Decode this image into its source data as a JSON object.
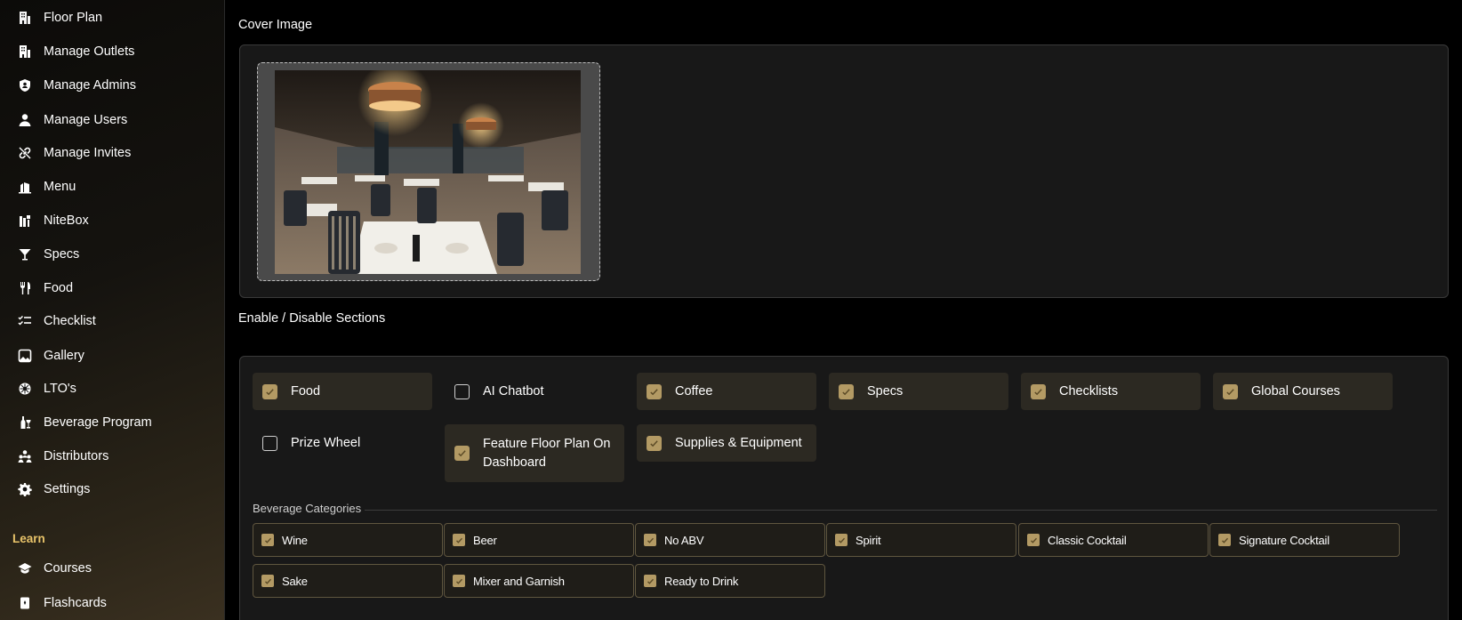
{
  "sidebar": {
    "items": [
      {
        "label": "Floor Plan",
        "icon": "building-icon"
      },
      {
        "label": "Manage Outlets",
        "icon": "store-icon"
      },
      {
        "label": "Manage Admins",
        "icon": "shield-user-icon"
      },
      {
        "label": "Manage Users",
        "icon": "user-icon"
      },
      {
        "label": "Manage Invites",
        "icon": "link-icon"
      },
      {
        "label": "Menu",
        "icon": "menu-book-icon"
      },
      {
        "label": "NiteBox",
        "icon": "box-icon"
      },
      {
        "label": "Specs",
        "icon": "cocktail-glass-icon"
      },
      {
        "label": "Food",
        "icon": "fork-knife-icon"
      },
      {
        "label": "Checklist",
        "icon": "checklist-icon"
      },
      {
        "label": "Gallery",
        "icon": "image-icon"
      },
      {
        "label": "LTO's",
        "icon": "dharma-wheel-icon"
      },
      {
        "label": "Beverage Program",
        "icon": "wine-bottle-icon"
      },
      {
        "label": "Distributors",
        "icon": "group-icon"
      },
      {
        "label": "Settings",
        "icon": "gear-icon"
      }
    ],
    "learn_section": "Learn",
    "learn_items": [
      {
        "label": "Courses",
        "icon": "graduation-cap-icon"
      },
      {
        "label": "Flashcards",
        "icon": "flashcard-icon"
      }
    ]
  },
  "main": {
    "cover_title": "Cover Image",
    "sections_title": "Enable / Disable Sections",
    "sections": [
      {
        "label": "Food",
        "checked": true
      },
      {
        "label": "AI Chatbot",
        "checked": false
      },
      {
        "label": "Coffee",
        "checked": true
      },
      {
        "label": "Specs",
        "checked": true
      },
      {
        "label": "Checklists",
        "checked": true
      },
      {
        "label": "Global Courses",
        "checked": true
      },
      {
        "label": "Prize Wheel",
        "checked": false
      },
      {
        "label": "Feature Floor Plan On Dashboard",
        "checked": true
      },
      {
        "label": "Supplies & Equipment",
        "checked": true
      }
    ],
    "beverage_categories_title": "Beverage Categories",
    "beverage_categories": [
      {
        "label": "Wine",
        "checked": true
      },
      {
        "label": "Beer",
        "checked": true
      },
      {
        "label": "No ABV",
        "checked": true
      },
      {
        "label": "Spirit",
        "checked": true
      },
      {
        "label": "Classic Cocktail",
        "checked": true
      },
      {
        "label": "Signature Cocktail",
        "checked": true
      },
      {
        "label": "Sake",
        "checked": true
      },
      {
        "label": "Mixer and Garnish",
        "checked": true
      },
      {
        "label": "Ready to Drink",
        "checked": true
      }
    ]
  },
  "colors": {
    "accent": "#e9c46a",
    "checkbox_fill": "#b39a64",
    "panel_bg": "#181818",
    "checked_bg": "#2c2922"
  }
}
